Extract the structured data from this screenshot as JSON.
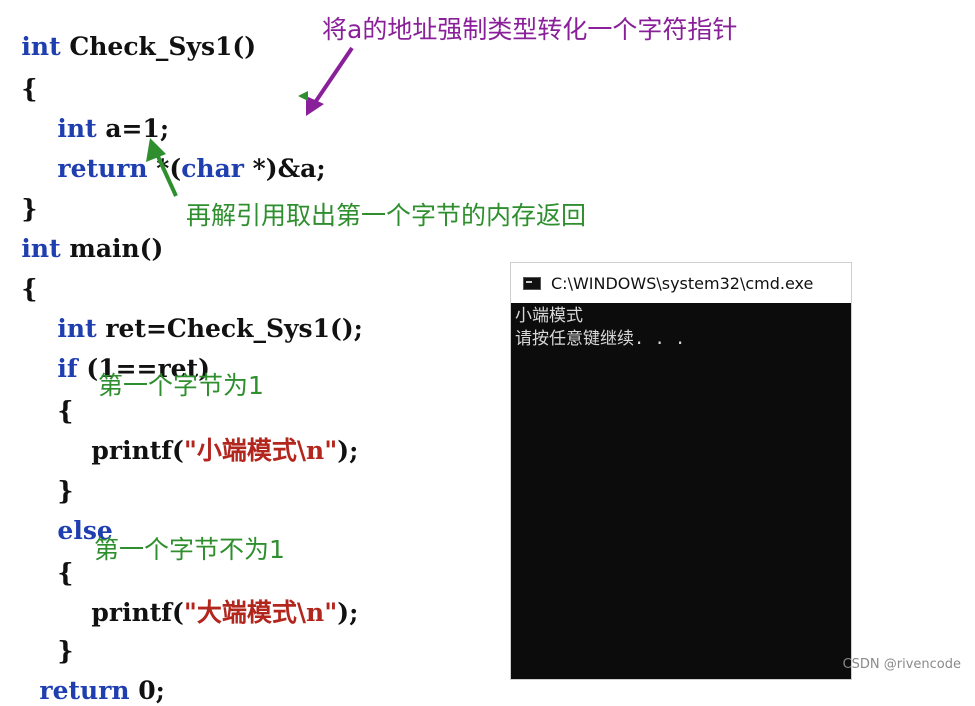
{
  "code": {
    "lines": [
      {
        "kw": "int",
        "rest": " Check_Sys1()"
      },
      {
        "plain": "{"
      },
      {
        "kw": "int",
        "rest": " a=1;"
      },
      {
        "kw": "return",
        "rest": " *(",
        "kw2": "char",
        "rest2": " *)&a;"
      },
      {
        "plain": "}"
      },
      {
        "kw": "int",
        "rest": " main()"
      },
      {
        "plain": "{"
      },
      {
        "kw": "int",
        "rest": " ret=Check_Sys1();"
      },
      {
        "kw": "if",
        "rest": " (1==ret)"
      },
      {
        "plain": "{"
      },
      {
        "prefix": "printf(",
        "q1": "\"",
        "str": "小端模式\\n",
        "q2": "\"",
        "suffix": ");"
      },
      {
        "plain": "}"
      },
      {
        "kw": "else"
      },
      {
        "plain": "{"
      },
      {
        "prefix": "printf(",
        "q1": "\"",
        "str": "大端模式\\n",
        "q2": "\"",
        "suffix": ");"
      },
      {
        "plain": "}"
      },
      {
        "kw": "return",
        "rest": " 0;"
      }
    ]
  },
  "annotations": {
    "top": "将a的地址强制类型转化一个字符指针",
    "deref": "再解引用取出第一个字节的内存返回",
    "first_byte_1": "第一个字节为1",
    "first_byte_not_1": "第一个字节不为1"
  },
  "terminal": {
    "title": "C:\\WINDOWS\\system32\\cmd.exe",
    "output_1": "小端模式",
    "output_2": "请按任意键继续. . ."
  },
  "watermark": "CSDN @rivencode",
  "colors": {
    "keyword": "#1f3fb0",
    "string": "#b3261e",
    "annotation_purple": "#8a1f9a",
    "annotation_green": "#2f8f2f",
    "terminal_bg": "#0c0c0c"
  }
}
